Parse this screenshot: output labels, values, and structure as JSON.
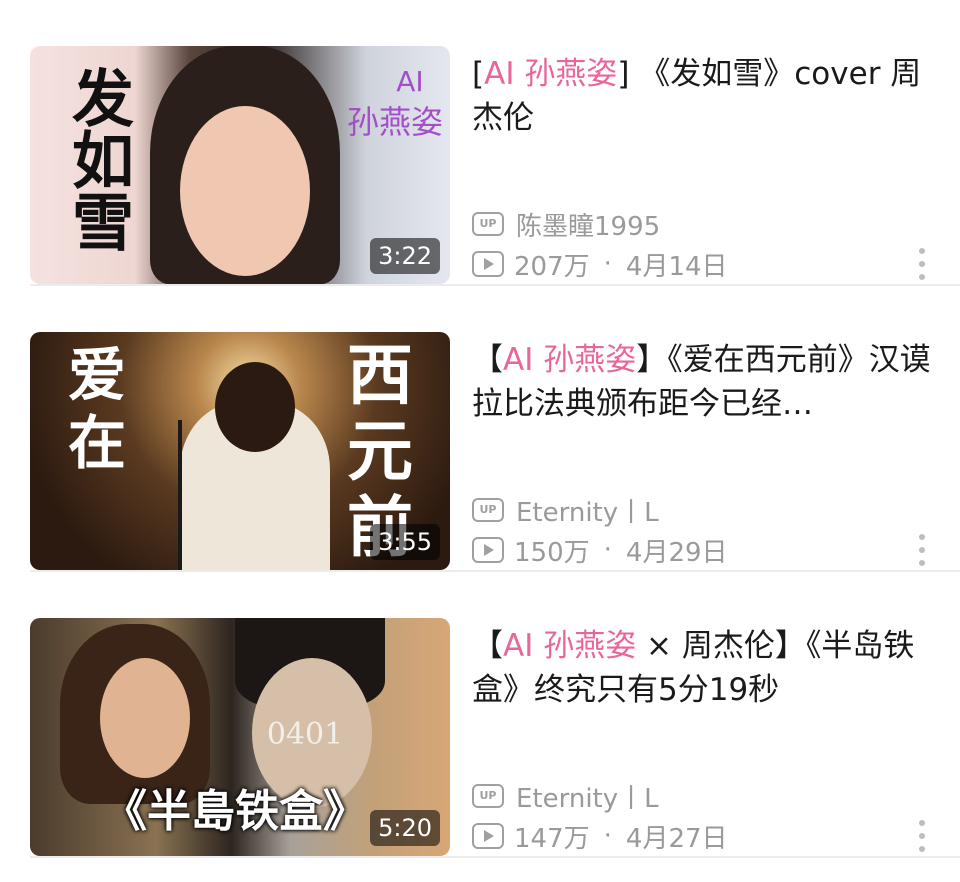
{
  "videos": [
    {
      "title_tag": "AI 孙燕姿",
      "title_prefix": "[",
      "title_rest": "] 《发如雪》cover 周杰伦",
      "thumb_text_left": "发如雪",
      "thumb_text_right": "AI 孙燕姿",
      "thumb_text_right_top": "AI",
      "thumb_text_right_bottom": "孙燕姿",
      "duration": "3:22",
      "uploader": "陈墨瞳1995",
      "views": "207万",
      "date": "4月14日"
    },
    {
      "title_tag": "AI 孙燕姿",
      "title_prefix": "【",
      "title_rest": "】《爱在西元前》汉谟拉比法典颁布距今已经…",
      "thumb_text_left_1": "爱",
      "thumb_text_left_2": "在",
      "thumb_text_right_1": "西",
      "thumb_text_right_2": "元",
      "thumb_text_right_3": "前",
      "duration": "3:55",
      "uploader": "Eternity丨L",
      "views": "150万",
      "date": "4月29日"
    },
    {
      "title_tag": "AI 孙燕姿",
      "title_prefix": "【",
      "title_rest": " × 周杰伦】《半岛铁盒》终究只有5分19秒",
      "thumb_text_bottom": "《半島铁盒》",
      "thumb_text_number": "0401",
      "duration": "5:20",
      "uploader": "Eternity丨L",
      "views": "147万",
      "date": "4月27日"
    }
  ],
  "icons": {
    "up": "up-badge-icon",
    "play": "play-icon",
    "more": "more-vertical-icon"
  },
  "ui": {
    "up_badge": "UP",
    "separator": "·"
  },
  "colors": {
    "accent_pink": "#e8669a",
    "meta_gray": "#9a9a9a"
  }
}
